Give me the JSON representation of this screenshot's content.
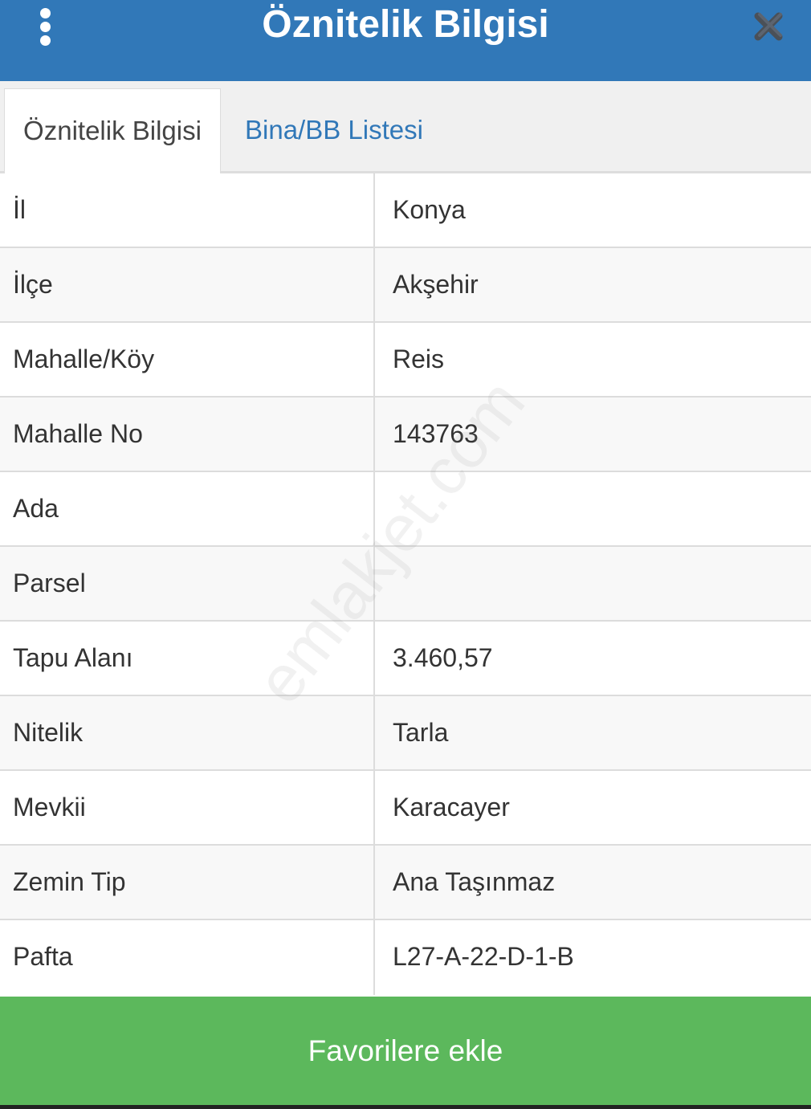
{
  "header": {
    "title": "Öznitelik Bilgisi",
    "menu_icon": "more-vertical-icon",
    "close_icon": "close-icon",
    "background_color": "#3178b8"
  },
  "tabs": [
    {
      "label": "Öznitelik Bilgisi",
      "active": true
    },
    {
      "label": "Bina/BB Listesi",
      "active": false
    }
  ],
  "attributes": [
    {
      "label": "İl",
      "value": "Konya"
    },
    {
      "label": "İlçe",
      "value": "Akşehir"
    },
    {
      "label": "Mahalle/Köy",
      "value": "Reis"
    },
    {
      "label": "Mahalle No",
      "value": "143763"
    },
    {
      "label": "Ada",
      "value": ""
    },
    {
      "label": "Parsel",
      "value": ""
    },
    {
      "label": "Tapu Alanı",
      "value": "3.460,57"
    },
    {
      "label": "Nitelik",
      "value": "Tarla"
    },
    {
      "label": "Mevkii",
      "value": "Karacayer"
    },
    {
      "label": "Zemin Tip",
      "value": "Ana Taşınmaz"
    },
    {
      "label": "Pafta",
      "value": "L27-A-22-D-1-B"
    }
  ],
  "watermark": "emlakjet.com",
  "footer": {
    "button_label": "Favorilere ekle",
    "button_color": "#5cb85c"
  }
}
